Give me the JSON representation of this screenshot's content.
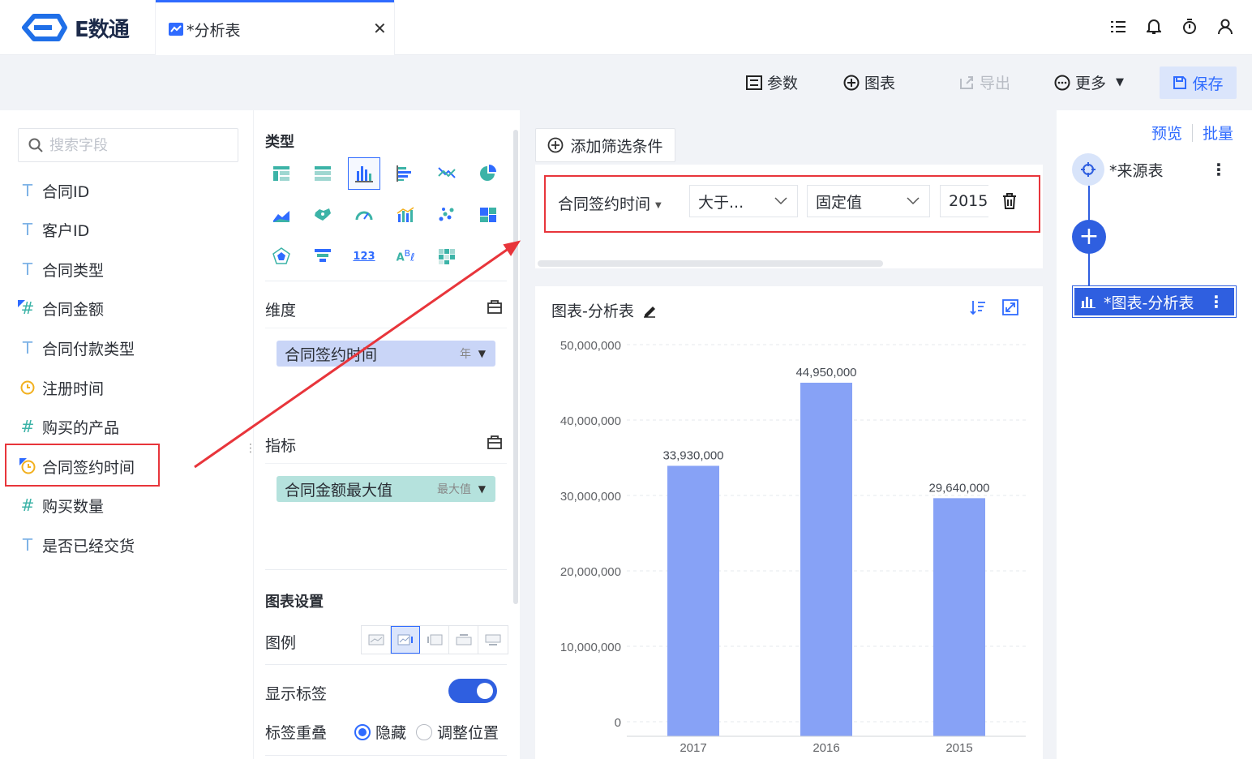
{
  "app": {
    "brand": "E数通"
  },
  "tab": {
    "label": "*分析表"
  },
  "toolbar": {
    "params": "参数",
    "chart": "图表",
    "export": "导出",
    "more": "更多",
    "save": "保存"
  },
  "fields": {
    "search_placeholder": "搜索字段",
    "items": [
      {
        "label": "合同ID",
        "type": "text"
      },
      {
        "label": "客户ID",
        "type": "text"
      },
      {
        "label": "合同类型",
        "type": "text"
      },
      {
        "label": "合同金额",
        "type": "number-modified"
      },
      {
        "label": "合同付款类型",
        "type": "text"
      },
      {
        "label": "注册时间",
        "type": "date"
      },
      {
        "label": "购买的产品",
        "type": "number"
      },
      {
        "label": "合同签约时间",
        "type": "date-modified"
      },
      {
        "label": "购买数量",
        "type": "number"
      },
      {
        "label": "是否已经交货",
        "type": "text"
      }
    ]
  },
  "config": {
    "type_title": "类型",
    "dimension_title": "维度",
    "dimension_pill": {
      "label": "合同签约时间",
      "sub": "年"
    },
    "metric_title": "指标",
    "metric_pill": {
      "label": "合同金额最大值",
      "sub": "最大值"
    },
    "settings_title": "图表设置",
    "legend_label": "图例",
    "show_label": "显示标签",
    "overlap_label": "标签重叠",
    "overlap_opt1": "隐藏",
    "overlap_opt2": "调整位置"
  },
  "filter": {
    "add_label": "添加筛选条件",
    "field": "合同签约时间",
    "operator": "大于...",
    "mode": "固定值",
    "value": "2015"
  },
  "chart_card": {
    "title": "图表-分析表"
  },
  "flow": {
    "preview": "预览",
    "batch": "批量",
    "source_node": "*来源表",
    "chart_node": "*图表-分析表"
  },
  "colors": {
    "accent": "#2f5fe0",
    "bar": "#87a2f6",
    "highlight": "#e8353b"
  },
  "chart_data": {
    "type": "bar",
    "categories": [
      "2017",
      "2016",
      "2015"
    ],
    "values": [
      33930000,
      44950000,
      29640000
    ],
    "value_labels": [
      "33,930,000",
      "44,950,000",
      "29,640,000"
    ],
    "y_ticks": [
      "0",
      "10,000,000",
      "20,000,000",
      "30,000,000",
      "40,000,000",
      "50,000,000"
    ],
    "ylim": [
      0,
      50000000
    ],
    "grid": true
  }
}
